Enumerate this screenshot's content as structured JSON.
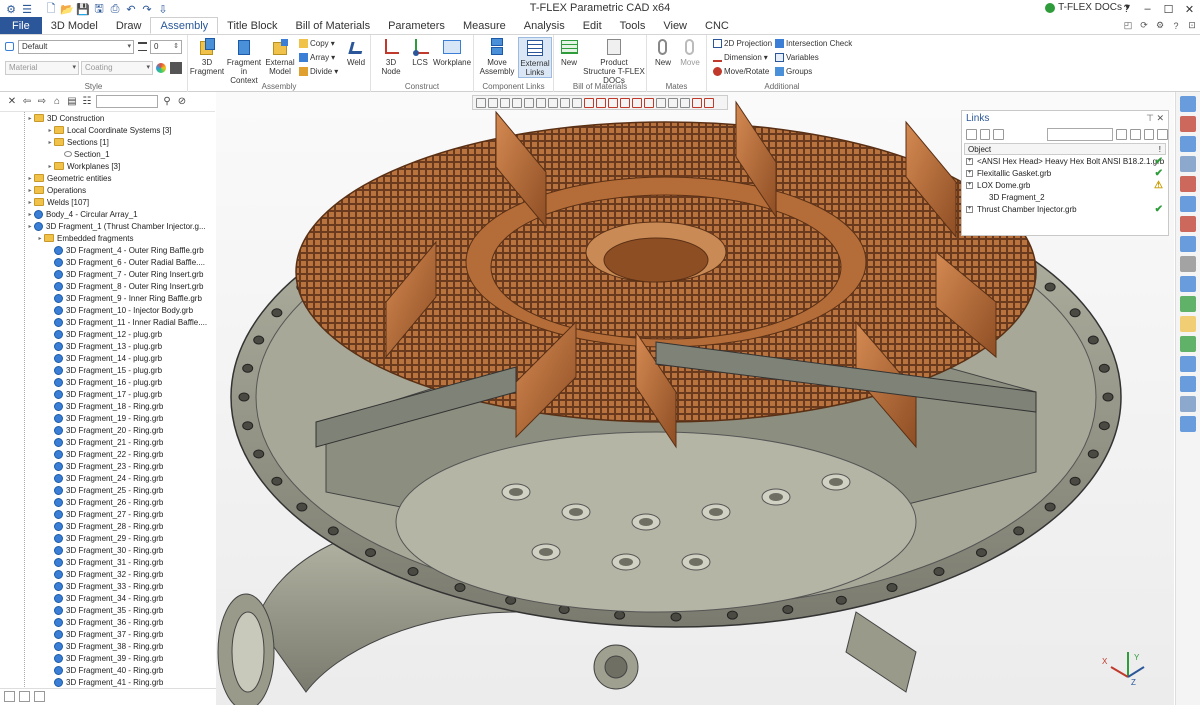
{
  "app": {
    "title": "T-FLEX Parametric CAD x64",
    "docs_label": "T-FLEX DOCs"
  },
  "tabs": [
    "File",
    "3D Model",
    "Draw",
    "Assembly",
    "Title Block",
    "Bill of Materials",
    "Parameters",
    "Measure",
    "Analysis",
    "Edit",
    "Tools",
    "View",
    "CNC"
  ],
  "active_tab": "Assembly",
  "style_group": {
    "label": "Style",
    "layer": "Default",
    "width": "0",
    "material": "Material",
    "coating": "Coating"
  },
  "assembly_group": {
    "label": "Assembly",
    "fragment": "3D Fragment",
    "fragment_in_context": "Fragment in Context",
    "external_model": "External Model",
    "copy": "Copy",
    "array": "Array",
    "divide": "Divide",
    "weld": "Weld"
  },
  "construct_group": {
    "label": "Construct",
    "node": "3D Node",
    "lcs": "LCS",
    "workplane": "Workplane"
  },
  "component_links_group": {
    "label": "Component Links",
    "move_assembly": "Move Assembly",
    "external_links": "External Links"
  },
  "bom_group": {
    "label": "Bill of Materials",
    "new": "New",
    "product_structure": "Product Structure T-FLEX DOCs"
  },
  "mates_group": {
    "label": "Mates",
    "new": "New",
    "move": "Move"
  },
  "additional_group": {
    "label": "Additional",
    "projection": "2D Projection",
    "dimension": "Dimension",
    "move_rotate": "Move/Rotate",
    "intersection_check": "Intersection Check",
    "variables": "Variables",
    "groups": "Groups"
  },
  "tree": {
    "items": [
      {
        "label": "3D Construction",
        "level": 0,
        "kind": "folder"
      },
      {
        "label": "Local Coordinate Systems [3]",
        "level": 2,
        "kind": "folder"
      },
      {
        "label": "Sections [1]",
        "level": 2,
        "kind": "folder"
      },
      {
        "label": "Section_1",
        "level": 3,
        "kind": "eye"
      },
      {
        "label": "Workplanes [3]",
        "level": 2,
        "kind": "folder"
      },
      {
        "label": "Geometric entities",
        "level": 0,
        "kind": "folder"
      },
      {
        "label": "Operations",
        "level": 0,
        "kind": "folder"
      },
      {
        "label": "Welds [107]",
        "level": 0,
        "kind": "folder"
      },
      {
        "label": "Body_4 - Circular Array_1",
        "level": 0,
        "kind": "body"
      },
      {
        "label": "3D Fragment_1 (Thrust Chamber Injector.g...",
        "level": 0,
        "kind": "body"
      },
      {
        "label": "Embedded fragments",
        "level": 1,
        "kind": "folder"
      },
      {
        "label": "3D Fragment_4 - Outer Ring Baffle.grb",
        "level": 2,
        "kind": "frag"
      },
      {
        "label": "3D Fragment_6 - Outer Radial Baffle....",
        "level": 2,
        "kind": "frag"
      },
      {
        "label": "3D Fragment_7 - Outer Ring Insert.grb",
        "level": 2,
        "kind": "frag"
      },
      {
        "label": "3D Fragment_8 - Outer Ring Insert.grb",
        "level": 2,
        "kind": "frag"
      },
      {
        "label": "3D Fragment_9 - Inner Ring Baffle.grb",
        "level": 2,
        "kind": "frag"
      },
      {
        "label": "3D Fragment_10 - Injector Body.grb",
        "level": 2,
        "kind": "frag"
      },
      {
        "label": "3D Fragment_11 - Inner Radial Baffle....",
        "level": 2,
        "kind": "frag"
      },
      {
        "label": "3D Fragment_12 - plug.grb",
        "level": 2,
        "kind": "frag"
      },
      {
        "label": "3D Fragment_13 - plug.grb",
        "level": 2,
        "kind": "frag"
      },
      {
        "label": "3D Fragment_14 - plug.grb",
        "level": 2,
        "kind": "frag"
      },
      {
        "label": "3D Fragment_15 - plug.grb",
        "level": 2,
        "kind": "frag"
      },
      {
        "label": "3D Fragment_16 - plug.grb",
        "level": 2,
        "kind": "frag"
      },
      {
        "label": "3D Fragment_17 - plug.grb",
        "level": 2,
        "kind": "frag"
      },
      {
        "label": "3D Fragment_18 - Ring.grb",
        "level": 2,
        "kind": "frag"
      },
      {
        "label": "3D Fragment_19 - Ring.grb",
        "level": 2,
        "kind": "frag"
      },
      {
        "label": "3D Fragment_20 - Ring.grb",
        "level": 2,
        "kind": "frag"
      },
      {
        "label": "3D Fragment_21 - Ring.grb",
        "level": 2,
        "kind": "frag"
      },
      {
        "label": "3D Fragment_22 - Ring.grb",
        "level": 2,
        "kind": "frag"
      },
      {
        "label": "3D Fragment_23 - Ring.grb",
        "level": 2,
        "kind": "frag"
      },
      {
        "label": "3D Fragment_24 - Ring.grb",
        "level": 2,
        "kind": "frag"
      },
      {
        "label": "3D Fragment_25 - Ring.grb",
        "level": 2,
        "kind": "frag"
      },
      {
        "label": "3D Fragment_26 - Ring.grb",
        "level": 2,
        "kind": "frag"
      },
      {
        "label": "3D Fragment_27 - Ring.grb",
        "level": 2,
        "kind": "frag"
      },
      {
        "label": "3D Fragment_28 - Ring.grb",
        "level": 2,
        "kind": "frag"
      },
      {
        "label": "3D Fragment_29 - Ring.grb",
        "level": 2,
        "kind": "frag"
      },
      {
        "label": "3D Fragment_30 - Ring.grb",
        "level": 2,
        "kind": "frag"
      },
      {
        "label": "3D Fragment_31 - Ring.grb",
        "level": 2,
        "kind": "frag"
      },
      {
        "label": "3D Fragment_32 - Ring.grb",
        "level": 2,
        "kind": "frag"
      },
      {
        "label": "3D Fragment_33 - Ring.grb",
        "level": 2,
        "kind": "frag"
      },
      {
        "label": "3D Fragment_34 - Ring.grb",
        "level": 2,
        "kind": "frag"
      },
      {
        "label": "3D Fragment_35 - Ring.grb",
        "level": 2,
        "kind": "frag"
      },
      {
        "label": "3D Fragment_36 - Ring.grb",
        "level": 2,
        "kind": "frag"
      },
      {
        "label": "3D Fragment_37 - Ring.grb",
        "level": 2,
        "kind": "frag"
      },
      {
        "label": "3D Fragment_38 - Ring.grb",
        "level": 2,
        "kind": "frag"
      },
      {
        "label": "3D Fragment_39 - Ring.grb",
        "level": 2,
        "kind": "frag"
      },
      {
        "label": "3D Fragment_40 - Ring.grb",
        "level": 2,
        "kind": "frag"
      },
      {
        "label": "3D Fragment_41 - Ring.grb",
        "level": 2,
        "kind": "frag"
      }
    ]
  },
  "links_panel": {
    "title": "Links",
    "column": "Object",
    "items": [
      {
        "label": "<ANSI Hex Head> Heavy Hex Bolt ANSI B18.2.1.grb",
        "status": "ok",
        "indent": 0
      },
      {
        "label": "Flexitallic Gasket.grb",
        "status": "ok",
        "indent": 0
      },
      {
        "label": "LOX Dome.grb",
        "status": "warn",
        "indent": 0
      },
      {
        "label": "3D Fragment_2",
        "status": "",
        "indent": 1
      },
      {
        "label": "Thrust Chamber Injector.grb",
        "status": "ok",
        "indent": 0
      }
    ]
  },
  "axes": {
    "x": "X",
    "y": "Y",
    "z": "Z"
  },
  "colors": {
    "accent": "#2b579a",
    "copper": "#b86b3a",
    "steel": "#9c9c8c",
    "ok": "#2e9c3a",
    "warn": "#c89b00"
  }
}
